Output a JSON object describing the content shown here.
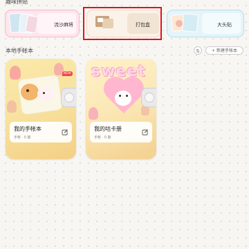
{
  "sections": {
    "fun_title": "趣味拼贴",
    "local_title": "本地手帐本"
  },
  "fun_cards": [
    {
      "label": "流沙麻将"
    },
    {
      "label": "打包盒"
    },
    {
      "label": "大头贴"
    }
  ],
  "toolbar": {
    "sort_icon": "⇅",
    "new_book_label": "+ 新建手帐本"
  },
  "books": [
    {
      "title": "我的手帐本",
      "meta": "手帐 · 0 篇",
      "badge": "NEW"
    },
    {
      "title": "我的咕卡册",
      "meta": "手帐 · 0 篇",
      "cover_text": "sweet"
    }
  ],
  "colors": {
    "highlight": "#e3101b",
    "badge": "#f3454e"
  }
}
